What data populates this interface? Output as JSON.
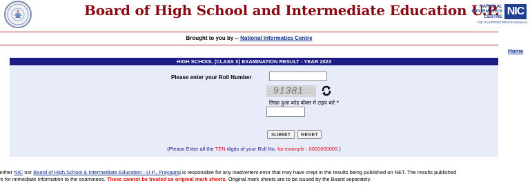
{
  "header": {
    "title": "Board of High School and Intermediate Education U.P.",
    "nic_logo": {
      "line1": "NATIONAL",
      "line2": "INFORMATICS",
      "line3": "CENTRE",
      "mark": "NIC",
      "tagline": "THE IT SUPPORT PROFESSIONALS"
    },
    "emblem_icon": "up-board-emblem-icon"
  },
  "brought_by": {
    "prefix": "Brought to you by -- ",
    "link": "National Informatics Centre"
  },
  "nav": {
    "home": "Home"
  },
  "form": {
    "heading": "HIGH SCHOOL (CLASS X)  EXAMINATION RESULT - YEAR 2023",
    "roll_label": "Please enter your Roll Number",
    "roll_value": "",
    "captcha_code": "91381",
    "captcha_hint": "लिखा हुआ कोड बॉक्स में टाइप करें *",
    "captcha_value": "",
    "refresh_icon": "refresh-icon",
    "submit_label": "SUBMIT",
    "reset_label": "RESET",
    "note": {
      "part1": "(Please Enter all the ",
      "ten": "TEN",
      "part2": " digits of your Roll No. ",
      "example": "for example : 0000000009",
      "part3": " )"
    }
  },
  "disclaimer": {
    "line1_prefix": "Neither ",
    "nic_link": "NIC",
    "line1_mid": " nor ",
    "board_link": "Board of High School & Intermediate Education - U.P., Prayagraj",
    "line1_suffix": " is responsible for any inadvertent error that may have crept in the results being published on NET. The results published",
    "line2_prefix": "are for immediate information to the examinees. ",
    "line2_warning": "These cannot be treated as original mark sheets",
    "line2_suffix": ". Original mark sheets are to be issued by the Board separately."
  },
  "colors": {
    "title": "#8b0a12",
    "header_bar": "#1c1c86",
    "box_bg": "#e8ebfa",
    "rule": "#c0282d",
    "link": "#0a2d8c",
    "warning": "#e01010"
  }
}
